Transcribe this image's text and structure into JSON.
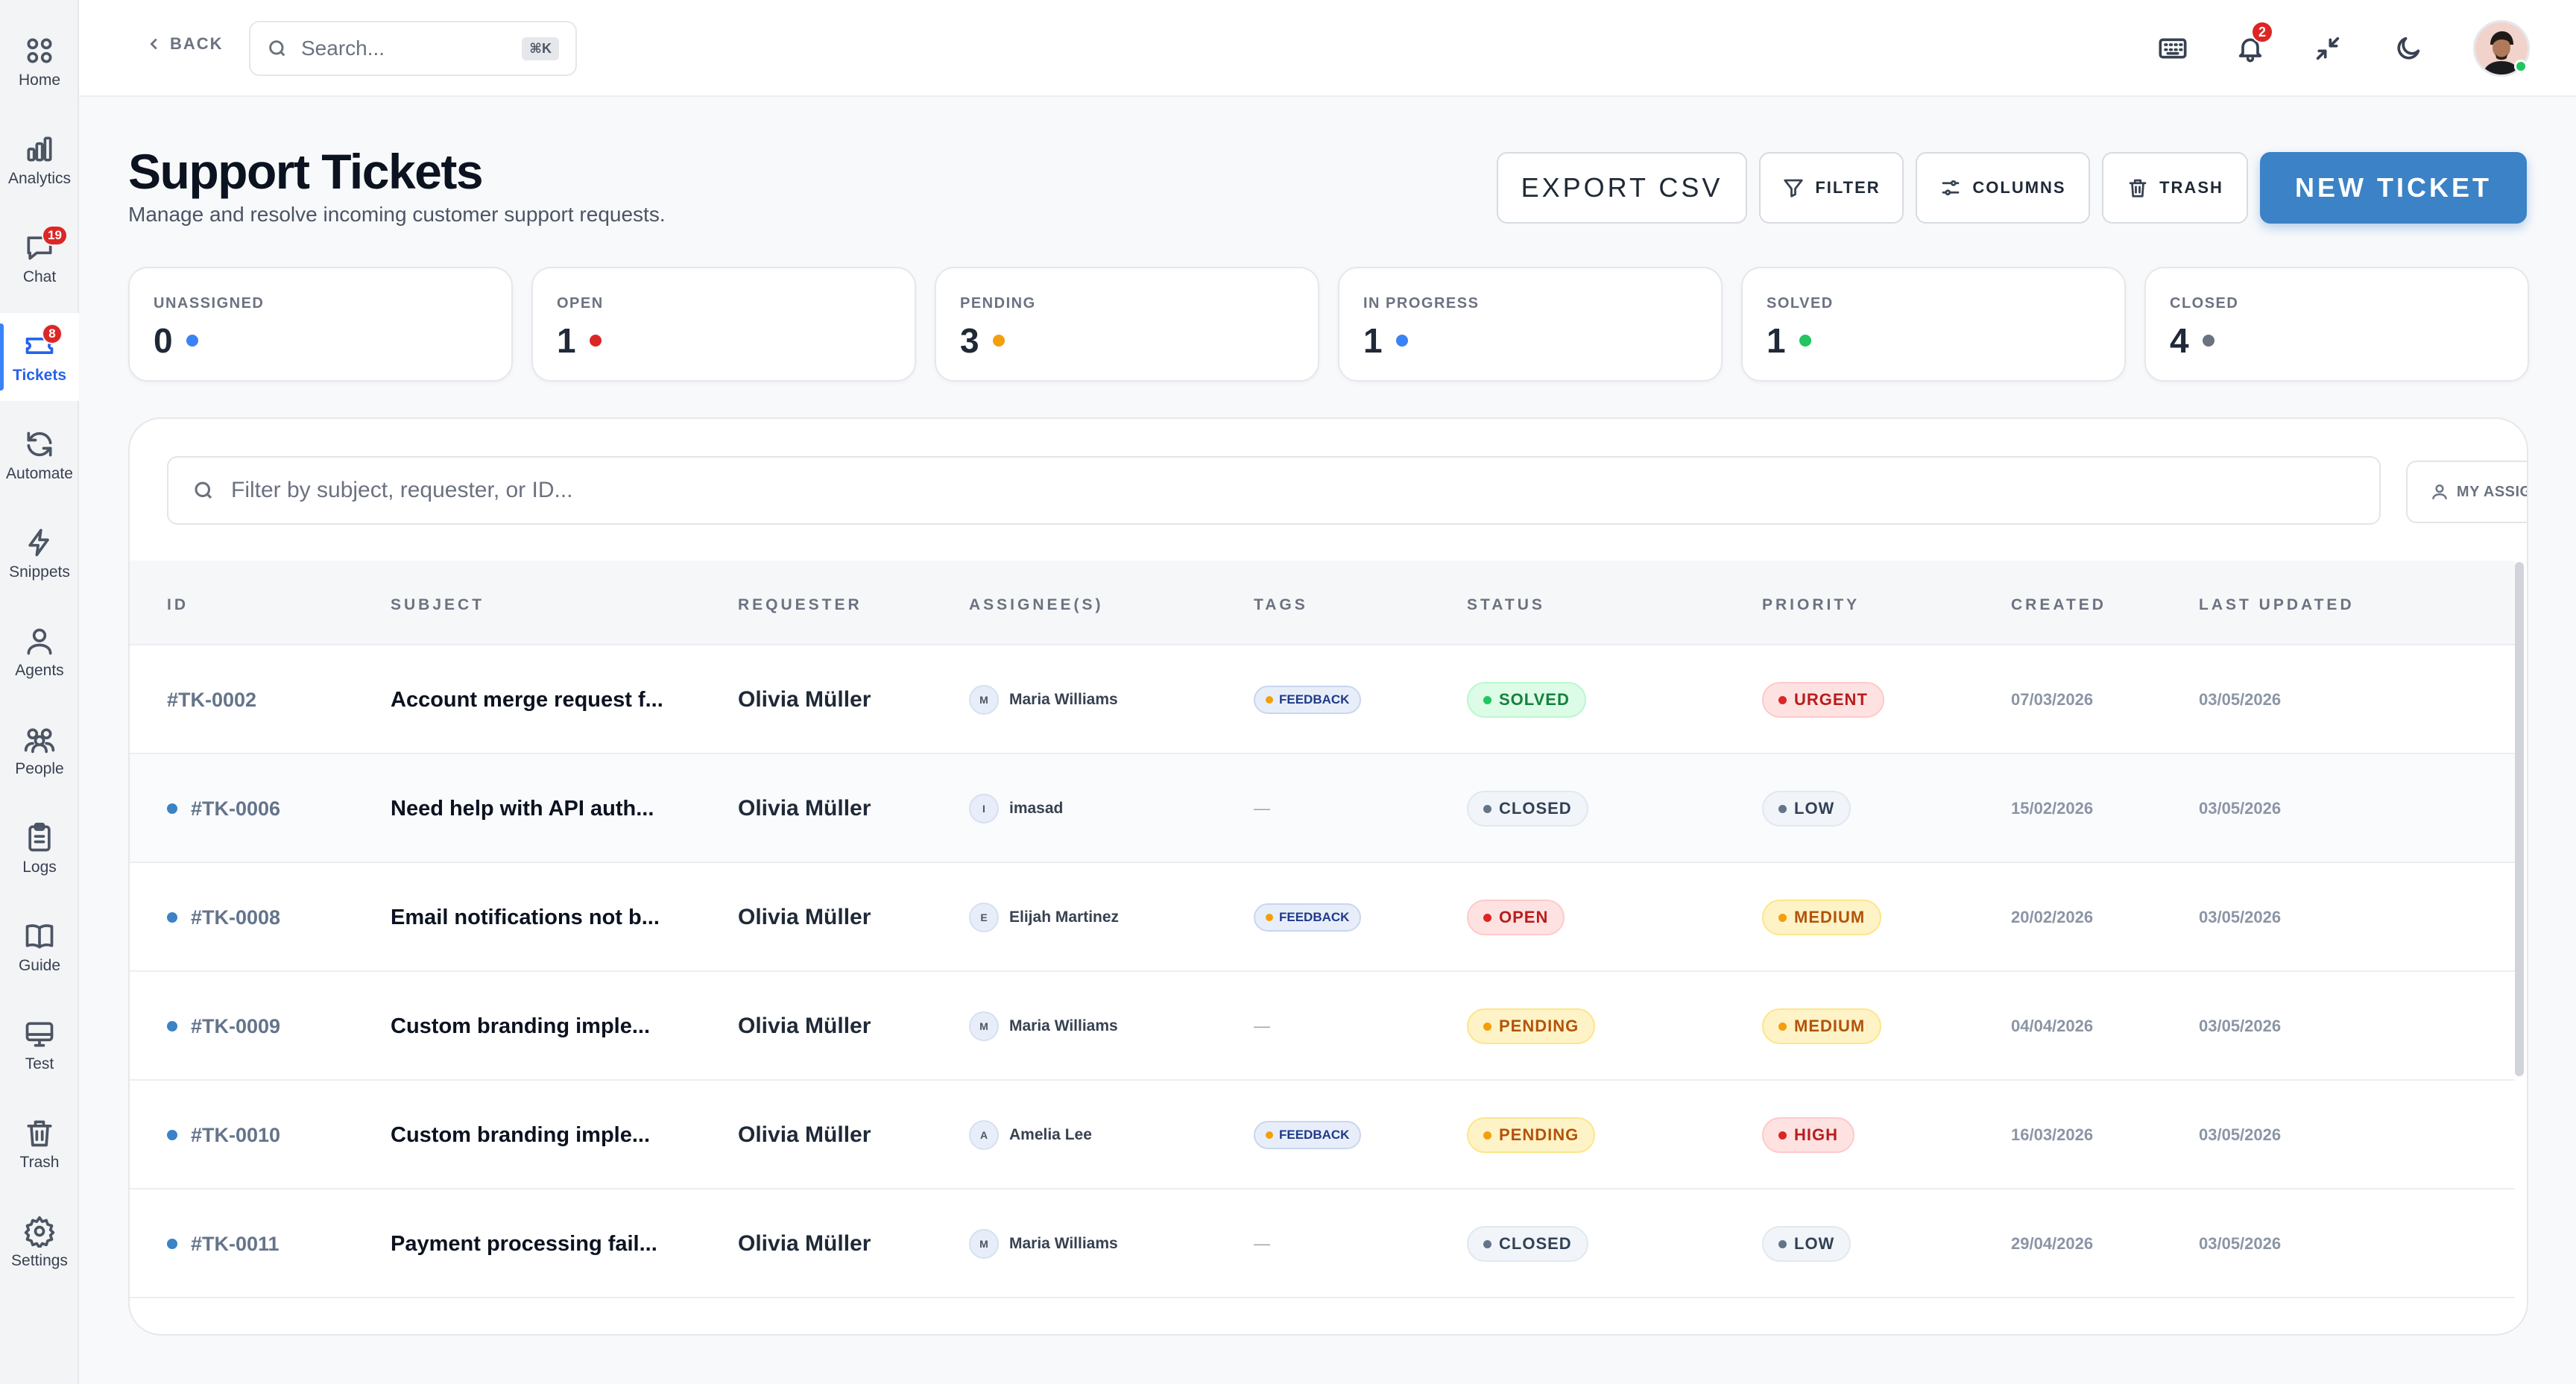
{
  "sidebar": {
    "items": [
      {
        "label": "Home",
        "icon": "grid-icon"
      },
      {
        "label": "Analytics",
        "icon": "bar-chart-icon"
      },
      {
        "label": "Chat",
        "icon": "chat-icon",
        "badge": "19"
      },
      {
        "label": "Tickets",
        "icon": "ticket-icon",
        "badge": "8",
        "active": true
      },
      {
        "label": "Automate",
        "icon": "refresh-icon"
      },
      {
        "label": "Snippets",
        "icon": "lightning-icon"
      },
      {
        "label": "Agents",
        "icon": "users-icon"
      },
      {
        "label": "People",
        "icon": "people-icon"
      },
      {
        "label": "Logs",
        "icon": "clipboard-icon"
      },
      {
        "label": "Guide",
        "icon": "book-icon"
      },
      {
        "label": "Test",
        "icon": "monitor-icon"
      },
      {
        "label": "Trash",
        "icon": "trash-icon"
      },
      {
        "label": "Settings",
        "icon": "gear-icon"
      }
    ]
  },
  "topbar": {
    "back_label": "BACK",
    "search_placeholder": "Search...",
    "search_shortcut": "⌘K",
    "notifications_count": "2"
  },
  "header": {
    "title": "Support Tickets",
    "subtitle": "Manage and resolve incoming customer support requests.",
    "export_label": "EXPORT CSV",
    "filter_label": "FILTER",
    "columns_label": "COLUMNS",
    "trash_label": "TRASH",
    "new_ticket_label": "NEW TICKET"
  },
  "stats": [
    {
      "label": "UNASSIGNED",
      "value": "0",
      "color": "#3b82f6"
    },
    {
      "label": "OPEN",
      "value": "1",
      "color": "#dc2626"
    },
    {
      "label": "PENDING",
      "value": "3",
      "color": "#f59e0b"
    },
    {
      "label": "IN PROGRESS",
      "value": "1",
      "color": "#3b82f6"
    },
    {
      "label": "SOLVED",
      "value": "1",
      "color": "#22c55e"
    },
    {
      "label": "CLOSED",
      "value": "4",
      "color": "#6b7280"
    }
  ],
  "table": {
    "filter_placeholder": "Filter by subject, requester, or ID...",
    "my_assignments_label": "MY ASSIGNMENTS",
    "columns": [
      "ID",
      "SUBJECT",
      "REQUESTER",
      "ASSIGNEE(S)",
      "TAGS",
      "STATUS",
      "PRIORITY",
      "CREATED",
      "LAST UPDATED"
    ],
    "rows": [
      {
        "id": "#TK-0002",
        "unread": false,
        "subject": "Account merge request f...",
        "requester": "Olivia Müller",
        "assignee_initial": "M",
        "assignee": "Maria Williams",
        "tag": "FEEDBACK",
        "status": "SOLVED",
        "priority": "URGENT",
        "created": "07/03/2026",
        "updated": "03/05/2026"
      },
      {
        "id": "#TK-0006",
        "unread": true,
        "subject": "Need help with API auth...",
        "requester": "Olivia Müller",
        "assignee_initial": "I",
        "assignee": "imasad",
        "tag": "",
        "status": "CLOSED",
        "priority": "LOW",
        "created": "15/02/2026",
        "updated": "03/05/2026"
      },
      {
        "id": "#TK-0008",
        "unread": true,
        "subject": "Email notifications not b...",
        "requester": "Olivia Müller",
        "assignee_initial": "E",
        "assignee": "Elijah Martinez",
        "tag": "FEEDBACK",
        "status": "OPEN",
        "priority": "MEDIUM",
        "created": "20/02/2026",
        "updated": "03/05/2026"
      },
      {
        "id": "#TK-0009",
        "unread": true,
        "subject": "Custom branding imple...",
        "requester": "Olivia Müller",
        "assignee_initial": "M",
        "assignee": "Maria Williams",
        "tag": "",
        "status": "PENDING",
        "priority": "MEDIUM",
        "created": "04/04/2026",
        "updated": "03/05/2026"
      },
      {
        "id": "#TK-0010",
        "unread": true,
        "subject": "Custom branding imple...",
        "requester": "Olivia Müller",
        "assignee_initial": "A",
        "assignee": "Amelia Lee",
        "tag": "FEEDBACK",
        "status": "PENDING",
        "priority": "HIGH",
        "created": "16/03/2026",
        "updated": "03/05/2026"
      },
      {
        "id": "#TK-0011",
        "unread": true,
        "subject": "Payment processing fail...",
        "requester": "Olivia Müller",
        "assignee_initial": "M",
        "assignee": "Maria Williams",
        "tag": "",
        "status": "CLOSED",
        "priority": "LOW",
        "created": "29/04/2026",
        "updated": "03/05/2026"
      }
    ],
    "empty_tag": "—"
  },
  "status_colors": {
    "SOLVED": {
      "bg": "#dcfce7",
      "border": "#bbf7d0",
      "text": "#15803d",
      "dot": "#22c55e"
    },
    "CLOSED": {
      "bg": "#f1f5f9",
      "border": "#e2e8f0",
      "text": "#334155",
      "dot": "#64748b"
    },
    "OPEN": {
      "bg": "#fee2e2",
      "border": "#fecaca",
      "text": "#b91c1c",
      "dot": "#dc2626"
    },
    "PENDING": {
      "bg": "#fef3c7",
      "border": "#fde68a",
      "text": "#b45309",
      "dot": "#f59e0b"
    }
  },
  "priority_colors": {
    "URGENT": {
      "bg": "#fee2e2",
      "border": "#fecaca",
      "text": "#b91c1c",
      "dot": "#dc2626"
    },
    "LOW": {
      "bg": "#f1f5f9",
      "border": "#e2e8f0",
      "text": "#334155",
      "dot": "#64748b"
    },
    "MEDIUM": {
      "bg": "#fef3c7",
      "border": "#fde68a",
      "text": "#b45309",
      "dot": "#f59e0b"
    },
    "HIGH": {
      "bg": "#fee2e2",
      "border": "#fecaca",
      "text": "#b91c1c",
      "dot": "#dc2626"
    }
  }
}
